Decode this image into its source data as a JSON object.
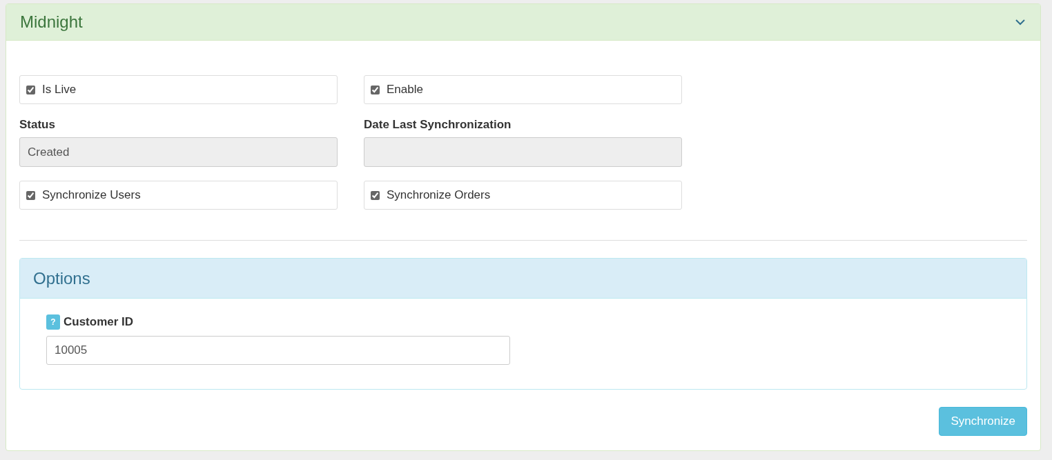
{
  "panel": {
    "title": "Midnight",
    "expanded": true
  },
  "rows": [
    {
      "kind": "checks",
      "items": [
        {
          "label": "Is Live",
          "checked": true
        },
        {
          "label": "Enable",
          "checked": true
        }
      ]
    },
    {
      "kind": "fields",
      "items": [
        {
          "label": "Status",
          "value": "Created"
        },
        {
          "label": "Date Last Synchronization"
        }
      ]
    },
    {
      "kind": "checks",
      "items": [
        {
          "label": "Synchronize Users",
          "checked": true
        },
        {
          "label": "Synchronize Orders",
          "checked": true
        }
      ]
    }
  ],
  "options": {
    "title": "Options",
    "fields": [
      {
        "help": "?",
        "label": "Customer ID",
        "value": "10005"
      }
    ]
  },
  "button": "Synchronize"
}
